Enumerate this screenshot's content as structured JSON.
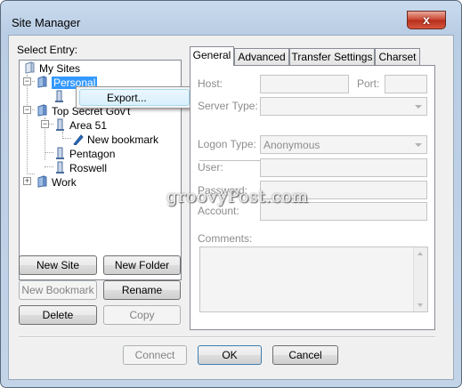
{
  "window": {
    "title": "Site Manager",
    "close_glyph": "x"
  },
  "tree": {
    "label": "Select Entry:",
    "root": "My Sites",
    "personal": "Personal",
    "top_secret": "Top Secret Gov't",
    "area51": "Area 51",
    "new_bookmark": "New bookmark",
    "pentagon": "Pentagon",
    "roswell": "Roswell",
    "work": "Work",
    "collapse_glyph": "−",
    "expand_glyph": "+"
  },
  "context_menu": {
    "export": "Export..."
  },
  "left_buttons": {
    "new_site": "New Site",
    "new_folder": "New Folder",
    "new_bookmark": "New Bookmark",
    "rename": "Rename",
    "delete": "Delete",
    "copy": "Copy"
  },
  "tabs": [
    "General",
    "Advanced",
    "Transfer Settings",
    "Charset"
  ],
  "general": {
    "host_label": "Host:",
    "port_label": "Port:",
    "server_type_label": "Server Type:",
    "logon_type_label": "Logon Type:",
    "logon_type_value": "Anonymous",
    "user_label": "User:",
    "password_label": "Password:",
    "account_label": "Account:",
    "comments_label": "Comments:"
  },
  "watermark": "groovyPost.com",
  "footer_buttons": {
    "connect": "Connect",
    "ok": "OK",
    "cancel": "Cancel"
  },
  "colors": {
    "selection": "#3399ff",
    "frame": "#c3d4e8",
    "close": "#c9412c"
  },
  "icons": [
    "folder-icon",
    "site-icon",
    "bookmark-icon",
    "close-icon"
  ]
}
